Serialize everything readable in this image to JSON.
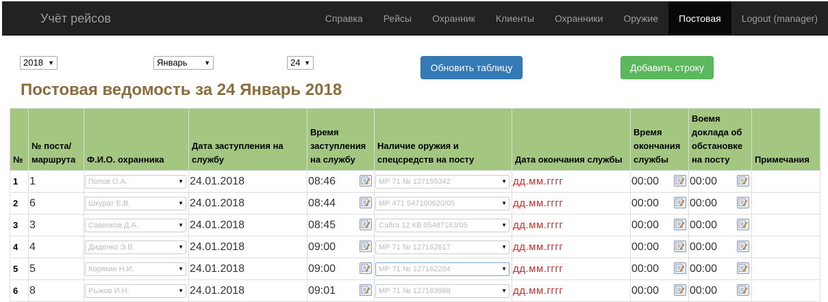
{
  "header": {
    "brand": "Учёт рейсов",
    "nav": [
      "Справка",
      "Рейсы",
      "Охранник",
      "Клиенты",
      "Охранники",
      "Оружие",
      "Постовая",
      "Logout (manager)"
    ],
    "active_index": 6
  },
  "filters": {
    "year": "2018",
    "month": "Январь",
    "day": "24"
  },
  "buttons": {
    "refresh": "Обновить таблицу",
    "add_row": "Добавить строку"
  },
  "page_title": "Постовая ведомость за 24 Январь 2018",
  "table": {
    "headers": [
      "№",
      "№ поста/ маршрута",
      "Ф.И.О. охранника",
      "Дата заступления на службу",
      "Время заступления на службу",
      "Наличие оружия и спецсредств на посту",
      "Дата окончания службы",
      "Время окончания службы",
      "Воемя доклада об обстановке на посту",
      "Примечания"
    ],
    "rows": [
      {
        "n": "1",
        "post": "1",
        "guard": "Попов О.А.",
        "start_date": "24.01.2018",
        "start_time": "08:46",
        "weapon": "МР 71 № 127159342",
        "end_date": "дд.мм.гггг",
        "end_time": "00:00",
        "report_time": "00:00",
        "notes": ""
      },
      {
        "n": "2",
        "post": "6",
        "guard": "Шкурат Е.В.",
        "start_date": "24.01.2018",
        "start_time": "08:44",
        "weapon": "МР 471 547100620/05",
        "end_date": "дд.мм.гггг",
        "end_time": "00:00",
        "report_time": "00:00",
        "notes": ""
      },
      {
        "n": "3",
        "post": "3",
        "guard": "Савенков Д.А.",
        "start_date": "24.01.2018",
        "start_time": "08:45",
        "weapon": "Сайга 12 КВ 05487163/05",
        "end_date": "дд.мм.гггг",
        "end_time": "00:00",
        "report_time": "00:00",
        "notes": ""
      },
      {
        "n": "4",
        "post": "4",
        "guard": "Диденко Э.В.",
        "start_date": "24.01.2018",
        "start_time": "09:00",
        "weapon": "МР 71 № 127162617",
        "end_date": "дд.мм.гггг",
        "end_time": "00:00",
        "report_time": "00:00",
        "notes": ""
      },
      {
        "n": "5",
        "post": "5",
        "guard": "Корякин Н.И.",
        "start_date": "24.01.2018",
        "start_time": "09:00",
        "weapon": "МР 71 № 127162284",
        "end_date": "дд.мм.гггг",
        "end_time": "00:00",
        "report_time": "00:00",
        "notes": ""
      },
      {
        "n": "6",
        "post": "8",
        "guard": "Рыжов И.Н.",
        "start_date": "24.01.2018",
        "start_time": "09:01",
        "weapon": "МР 71 № 127163988",
        "end_date": "дд.мм.гггг",
        "end_time": "00:00",
        "report_time": "00:00",
        "notes": ""
      }
    ]
  },
  "icons": {
    "dropdown": "chevron-down-icon",
    "edit": "edit-note-icon"
  }
}
